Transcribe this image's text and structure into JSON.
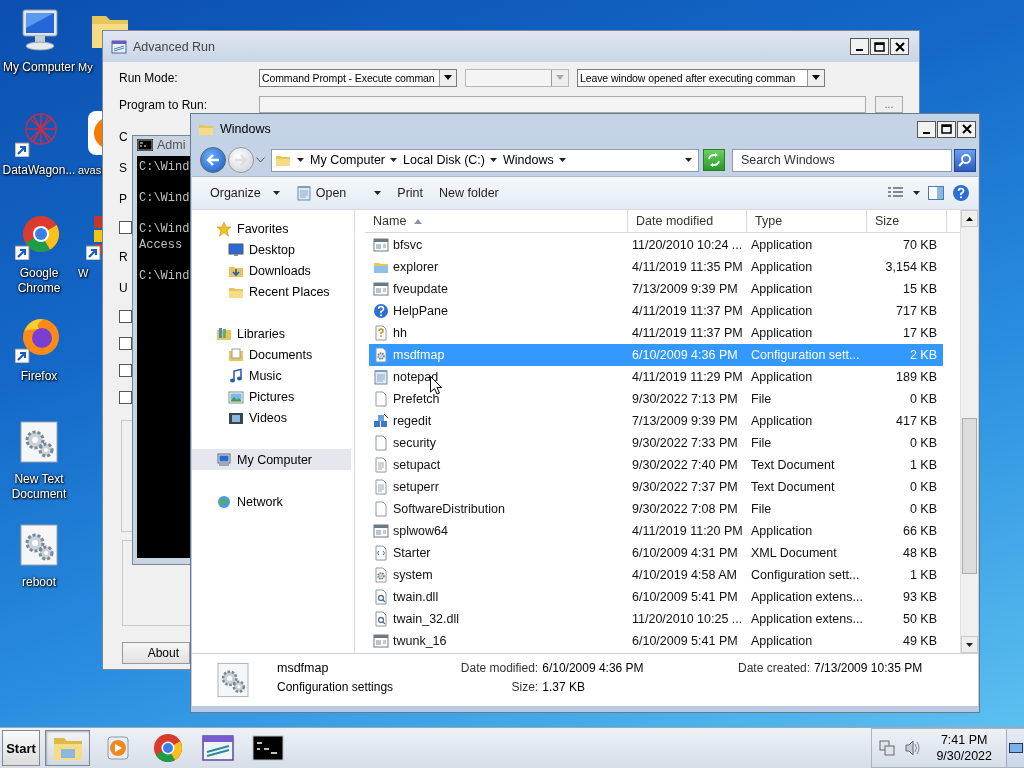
{
  "desktop_icons": [
    {
      "label": "My Computer",
      "kind": "computer"
    },
    {
      "label": "DataWagon...",
      "kind": "mesh"
    },
    {
      "label": "Google Chrome",
      "kind": "chrome"
    },
    {
      "label": "Firefox",
      "kind": "firefox"
    },
    {
      "label": "New Text Document",
      "kind": "config"
    },
    {
      "label": "reboot",
      "kind": "config"
    },
    {
      "label": "My",
      "kind": "folder"
    },
    {
      "label": "avas",
      "kind": "avast"
    },
    {
      "label": "W",
      "kind": "tools"
    }
  ],
  "advanced_run": {
    "title": "Advanced Run",
    "run_mode_label": "Run Mode:",
    "run_mode": [
      {
        "value": "Command Prompt - Execute comman",
        "disabled": false
      },
      {
        "disabled": true
      },
      {
        "value": "Leave window opened after executing comman",
        "disabled": false
      }
    ],
    "program_label": "Program to Run:",
    "browse": "...",
    "left_items": [
      {
        "kind": "label",
        "text": "C"
      },
      {
        "kind": "label",
        "text": "S"
      },
      {
        "kind": "label",
        "text": "P"
      },
      {
        "kind": "checkbox",
        "checked": false
      },
      {
        "kind": "label",
        "text": "R"
      },
      {
        "kind": "label",
        "text": "U"
      },
      {
        "kind": "checkbox",
        "checked": false
      },
      {
        "kind": "checkbox",
        "checked": false
      },
      {
        "kind": "checkbox",
        "checked": false
      },
      {
        "kind": "checkbox",
        "checked": false
      }
    ],
    "about": "About"
  },
  "console": {
    "title": "Admi",
    "blocks": [
      [
        "C:\\Wind"
      ],
      [
        "C:\\Wind"
      ],
      [
        "C:\\Wind",
        "Access"
      ],
      [
        "C:\\Wind"
      ]
    ]
  },
  "explorer": {
    "title": "Windows",
    "breadcrumb": [
      "My Computer",
      "Local Disk (C:)",
      "Windows"
    ],
    "search_placeholder": "Search Windows",
    "toolbar": [
      {
        "label": "Organize",
        "kind": "menu"
      },
      {
        "label": "Open",
        "kind": "open"
      },
      {
        "label": "Print",
        "kind": "plain"
      },
      {
        "label": "New folder",
        "kind": "plain"
      }
    ],
    "nav": [
      {
        "label": "Favorites",
        "kind": "star",
        "selected": false,
        "children": [
          {
            "label": "Desktop",
            "kind": "desktop",
            "selected": false
          },
          {
            "label": "Downloads",
            "kind": "downloads",
            "selected": false
          },
          {
            "label": "Recent Places",
            "kind": "places",
            "selected": false
          }
        ]
      },
      {
        "label": "Libraries",
        "kind": "library",
        "selected": false,
        "children": [
          {
            "label": "Documents",
            "kind": "documents",
            "selected": false
          },
          {
            "label": "Music",
            "kind": "music",
            "selected": false
          },
          {
            "label": "Pictures",
            "kind": "pictures",
            "selected": false
          },
          {
            "label": "Videos",
            "kind": "videos",
            "selected": false
          }
        ]
      },
      {
        "label": "My Computer",
        "kind": "computer",
        "selected": true
      },
      {
        "label": "Network",
        "kind": "network",
        "selected": false
      }
    ],
    "columns": [
      {
        "label": "Name",
        "sorted": true
      },
      {
        "label": "Date modified",
        "sorted": false
      },
      {
        "label": "Type",
        "sorted": false
      },
      {
        "label": "Size",
        "sorted": false
      }
    ],
    "rows": [
      {
        "name": "bfsvc",
        "date": "11/20/2010 10:24 ...",
        "type": "Application",
        "size": "70 KB",
        "kind": "app",
        "selected": false
      },
      {
        "name": "explorer",
        "date": "4/11/2019 11:35 PM",
        "type": "Application",
        "size": "3,154 KB",
        "kind": "explorer",
        "selected": false
      },
      {
        "name": "fveupdate",
        "date": "7/13/2009 9:39 PM",
        "type": "Application",
        "size": "15 KB",
        "kind": "app",
        "selected": false
      },
      {
        "name": "HelpPane",
        "date": "4/11/2019 11:37 PM",
        "type": "Application",
        "size": "717 KB",
        "kind": "help",
        "selected": false
      },
      {
        "name": "hh",
        "date": "4/11/2019 11:37 PM",
        "type": "Application",
        "size": "17 KB",
        "kind": "hh",
        "selected": false
      },
      {
        "name": "msdfmap",
        "date": "6/10/2009 4:36 PM",
        "type": "Configuration sett...",
        "size": "2 KB",
        "kind": "config",
        "selected": true
      },
      {
        "name": "notepad",
        "date": "4/11/2019 11:29 PM",
        "type": "Application",
        "size": "189 KB",
        "kind": "notepad",
        "selected": false
      },
      {
        "name": "Prefetch",
        "date": "9/30/2022 7:13 PM",
        "type": "File",
        "size": "0 KB",
        "kind": "file",
        "selected": false
      },
      {
        "name": "regedit",
        "date": "7/13/2009 9:39 PM",
        "type": "Application",
        "size": "417 KB",
        "kind": "regedit",
        "selected": false
      },
      {
        "name": "security",
        "date": "9/30/2022 7:33 PM",
        "type": "File",
        "size": "0 KB",
        "kind": "file",
        "selected": false
      },
      {
        "name": "setupact",
        "date": "9/30/2022 7:40 PM",
        "type": "Text Document",
        "size": "1 KB",
        "kind": "text",
        "selected": false
      },
      {
        "name": "setuperr",
        "date": "9/30/2022 7:37 PM",
        "type": "Text Document",
        "size": "0 KB",
        "kind": "text",
        "selected": false
      },
      {
        "name": "SoftwareDistribution",
        "date": "9/30/2022 7:08 PM",
        "type": "File",
        "size": "0 KB",
        "kind": "file",
        "selected": false
      },
      {
        "name": "splwow64",
        "date": "4/11/2019 11:20 PM",
        "type": "Application",
        "size": "66 KB",
        "kind": "app",
        "selected": false
      },
      {
        "name": "Starter",
        "date": "6/10/2009 4:31 PM",
        "type": "XML Document",
        "size": "48 KB",
        "kind": "xml",
        "selected": false
      },
      {
        "name": "system",
        "date": "4/10/2019 4:58 AM",
        "type": "Configuration sett...",
        "size": "1 KB",
        "kind": "config",
        "selected": false
      },
      {
        "name": "twain.dll",
        "date": "6/10/2009 5:41 PM",
        "type": "Application extens...",
        "size": "93 KB",
        "kind": "dll",
        "selected": false
      },
      {
        "name": "twain_32.dll",
        "date": "11/20/2010 10:25 ...",
        "type": "Application extens...",
        "size": "50 KB",
        "kind": "dll",
        "selected": false
      },
      {
        "name": "twunk_16",
        "date": "6/10/2009 5:41 PM",
        "type": "Application",
        "size": "49 KB",
        "kind": "app",
        "selected": false
      }
    ],
    "details": {
      "name": "msdfmap",
      "type": "Configuration settings",
      "fields": [
        {
          "label": "Date modified:",
          "value": "6/10/2009 4:36 PM"
        },
        {
          "label": "Date created:",
          "value": "7/13/2009 10:35 PM"
        },
        {
          "label": "Size:",
          "value": "1.37 KB"
        }
      ]
    }
  },
  "taskbar": {
    "start": "Start",
    "tasks": [
      {
        "kind": "explorer",
        "selected": true
      },
      {
        "kind": "media",
        "selected": false
      },
      {
        "kind": "chrome",
        "selected": false
      },
      {
        "kind": "advrun",
        "selected": false
      },
      {
        "kind": "console",
        "selected": false
      }
    ],
    "clock": {
      "time": "7:41 PM",
      "date": "9/30/2022"
    }
  }
}
